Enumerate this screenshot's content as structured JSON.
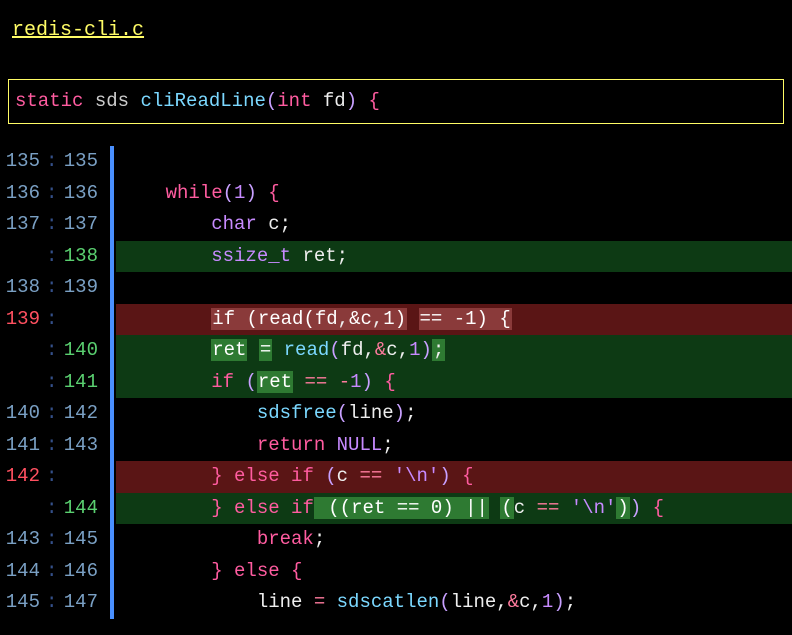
{
  "filename": "redis-cli.c",
  "hunk": {
    "kw1": "static",
    "type": "sds",
    "fn": "cliReadLine",
    "paren_open": "(",
    "argtype": "int",
    "argname": "fd",
    "paren_close": ")",
    "brace": "{"
  },
  "sep": ":",
  "lines": [
    {
      "old": "135",
      "new": "135",
      "kind": "ctx",
      "tokens": []
    },
    {
      "old": "136",
      "new": "136",
      "kind": "ctx",
      "tokens": [
        {
          "t": "plain",
          "v": "    "
        },
        {
          "t": "kw",
          "v": "while"
        },
        {
          "t": "br",
          "v": "("
        },
        {
          "t": "num",
          "v": "1"
        },
        {
          "t": "br",
          "v": ")"
        },
        {
          "t": "plain",
          "v": " "
        },
        {
          "t": "cb",
          "v": "{"
        }
      ]
    },
    {
      "old": "137",
      "new": "137",
      "kind": "ctx",
      "tokens": [
        {
          "t": "plain",
          "v": "        "
        },
        {
          "t": "type",
          "v": "char"
        },
        {
          "t": "plain",
          "v": " c"
        },
        {
          "t": "punc",
          "v": ";"
        }
      ]
    },
    {
      "old": "",
      "new": "138",
      "kind": "add",
      "tokens": [
        {
          "t": "plain",
          "v": "        "
        },
        {
          "t": "type",
          "v": "ssize_t"
        },
        {
          "t": "plain",
          "v": " ret"
        },
        {
          "t": "punc",
          "v": ";"
        }
      ]
    },
    {
      "old": "138",
      "new": "139",
      "kind": "ctx",
      "tokens": []
    },
    {
      "old": "139",
      "new": "",
      "kind": "del",
      "tokens": [
        {
          "t": "plain",
          "v": "        "
        },
        {
          "t": "hl-del",
          "children": [
            {
              "t": "kw",
              "v": "if"
            },
            {
              "t": "plain",
              "v": " "
            },
            {
              "t": "br",
              "v": "("
            },
            {
              "t": "id",
              "v": "read"
            },
            {
              "t": "br",
              "v": "("
            },
            {
              "t": "id",
              "v": "fd"
            },
            {
              "t": "punc",
              "v": ","
            },
            {
              "t": "op",
              "v": "&"
            },
            {
              "t": "id",
              "v": "c"
            },
            {
              "t": "punc",
              "v": ","
            },
            {
              "t": "num",
              "v": "1"
            },
            {
              "t": "br",
              "v": ")"
            }
          ]
        },
        {
          "t": "plain",
          "v": " "
        },
        {
          "t": "hl-del",
          "children": [
            {
              "t": "op",
              "v": "=="
            },
            {
              "t": "plain",
              "v": " "
            },
            {
              "t": "op",
              "v": "-"
            },
            {
              "t": "num",
              "v": "1"
            },
            {
              "t": "br",
              "v": ")"
            },
            {
              "t": "plain",
              "v": " "
            },
            {
              "t": "cb",
              "v": "{"
            }
          ]
        }
      ]
    },
    {
      "old": "",
      "new": "140",
      "kind": "add",
      "tokens": [
        {
          "t": "plain",
          "v": "        "
        },
        {
          "t": "hl-add",
          "children": [
            {
              "t": "id",
              "v": "ret"
            }
          ]
        },
        {
          "t": "plain",
          "v": " "
        },
        {
          "t": "hl-add",
          "children": [
            {
              "t": "op",
              "v": "="
            }
          ]
        },
        {
          "t": "plain",
          "v": " "
        },
        {
          "t": "fn",
          "v": "read"
        },
        {
          "t": "br",
          "v": "("
        },
        {
          "t": "id",
          "v": "fd"
        },
        {
          "t": "punc",
          "v": ","
        },
        {
          "t": "op",
          "v": "&"
        },
        {
          "t": "id",
          "v": "c"
        },
        {
          "t": "punc",
          "v": ","
        },
        {
          "t": "num",
          "v": "1"
        },
        {
          "t": "br",
          "v": ")"
        },
        {
          "t": "hl-add",
          "children": [
            {
              "t": "punc",
              "v": ";"
            }
          ]
        }
      ]
    },
    {
      "old": "",
      "new": "141",
      "kind": "add",
      "tokens": [
        {
          "t": "plain",
          "v": "        "
        },
        {
          "t": "kw",
          "v": "if"
        },
        {
          "t": "plain",
          "v": " "
        },
        {
          "t": "br",
          "v": "("
        },
        {
          "t": "hl-add",
          "children": [
            {
              "t": "id",
              "v": "ret"
            }
          ]
        },
        {
          "t": "plain",
          "v": " "
        },
        {
          "t": "op",
          "v": "=="
        },
        {
          "t": "plain",
          "v": " "
        },
        {
          "t": "op",
          "v": "-"
        },
        {
          "t": "num",
          "v": "1"
        },
        {
          "t": "br",
          "v": ")"
        },
        {
          "t": "plain",
          "v": " "
        },
        {
          "t": "cb",
          "v": "{"
        }
      ]
    },
    {
      "old": "140",
      "new": "142",
      "kind": "ctx",
      "tokens": [
        {
          "t": "plain",
          "v": "            "
        },
        {
          "t": "fn",
          "v": "sdsfree"
        },
        {
          "t": "br",
          "v": "("
        },
        {
          "t": "id",
          "v": "line"
        },
        {
          "t": "br",
          "v": ")"
        },
        {
          "t": "punc",
          "v": ";"
        }
      ]
    },
    {
      "old": "141",
      "new": "143",
      "kind": "ctx",
      "tokens": [
        {
          "t": "plain",
          "v": "            "
        },
        {
          "t": "kw",
          "v": "return"
        },
        {
          "t": "plain",
          "v": " "
        },
        {
          "t": "null",
          "v": "NULL"
        },
        {
          "t": "punc",
          "v": ";"
        }
      ]
    },
    {
      "old": "142",
      "new": "",
      "kind": "del",
      "tokens": [
        {
          "t": "plain",
          "v": "        "
        },
        {
          "t": "cb",
          "v": "}"
        },
        {
          "t": "plain",
          "v": " "
        },
        {
          "t": "kw",
          "v": "else"
        },
        {
          "t": "plain",
          "v": " "
        },
        {
          "t": "kw",
          "v": "if"
        },
        {
          "t": "plain",
          "v": " "
        },
        {
          "t": "br",
          "v": "("
        },
        {
          "t": "id",
          "v": "c"
        },
        {
          "t": "plain",
          "v": " "
        },
        {
          "t": "op",
          "v": "=="
        },
        {
          "t": "plain",
          "v": " "
        },
        {
          "t": "str",
          "v": "'\\n'"
        },
        {
          "t": "br",
          "v": ")"
        },
        {
          "t": "plain",
          "v": " "
        },
        {
          "t": "cb",
          "v": "{"
        }
      ]
    },
    {
      "old": "",
      "new": "144",
      "kind": "add",
      "tokens": [
        {
          "t": "plain",
          "v": "        "
        },
        {
          "t": "cb",
          "v": "}"
        },
        {
          "t": "plain",
          "v": " "
        },
        {
          "t": "kw",
          "v": "else"
        },
        {
          "t": "plain",
          "v": " "
        },
        {
          "t": "kw",
          "v": "if"
        },
        {
          "t": "hl-add",
          "children": [
            {
              "t": "plain",
              "v": " "
            }
          ]
        },
        {
          "t": "hl-add",
          "children": [
            {
              "t": "br",
              "v": "(("
            },
            {
              "t": "id",
              "v": "ret"
            },
            {
              "t": "plain",
              "v": " "
            },
            {
              "t": "op",
              "v": "=="
            },
            {
              "t": "plain",
              "v": " "
            },
            {
              "t": "num",
              "v": "0"
            },
            {
              "t": "br",
              "v": ")"
            },
            {
              "t": "plain",
              "v": " "
            },
            {
              "t": "op",
              "v": "||"
            }
          ]
        },
        {
          "t": "plain",
          "v": " "
        },
        {
          "t": "hl-add",
          "children": [
            {
              "t": "br",
              "v": "("
            }
          ]
        },
        {
          "t": "id",
          "v": "c"
        },
        {
          "t": "plain",
          "v": " "
        },
        {
          "t": "op",
          "v": "=="
        },
        {
          "t": "plain",
          "v": " "
        },
        {
          "t": "str",
          "v": "'\\n'"
        },
        {
          "t": "hl-add",
          "children": [
            {
              "t": "br",
              "v": ")"
            }
          ]
        },
        {
          "t": "br",
          "v": ")"
        },
        {
          "t": "plain",
          "v": " "
        },
        {
          "t": "cb",
          "v": "{"
        }
      ]
    },
    {
      "old": "143",
      "new": "145",
      "kind": "ctx",
      "tokens": [
        {
          "t": "plain",
          "v": "            "
        },
        {
          "t": "kw",
          "v": "break"
        },
        {
          "t": "punc",
          "v": ";"
        }
      ]
    },
    {
      "old": "144",
      "new": "146",
      "kind": "ctx",
      "tokens": [
        {
          "t": "plain",
          "v": "        "
        },
        {
          "t": "cb",
          "v": "}"
        },
        {
          "t": "plain",
          "v": " "
        },
        {
          "t": "kw",
          "v": "else"
        },
        {
          "t": "plain",
          "v": " "
        },
        {
          "t": "cb",
          "v": "{"
        }
      ]
    },
    {
      "old": "145",
      "new": "147",
      "kind": "ctx",
      "tokens": [
        {
          "t": "plain",
          "v": "            "
        },
        {
          "t": "id",
          "v": "line"
        },
        {
          "t": "plain",
          "v": " "
        },
        {
          "t": "op",
          "v": "="
        },
        {
          "t": "plain",
          "v": " "
        },
        {
          "t": "fn",
          "v": "sdscatlen"
        },
        {
          "t": "br",
          "v": "("
        },
        {
          "t": "id",
          "v": "line"
        },
        {
          "t": "punc",
          "v": ","
        },
        {
          "t": "op",
          "v": "&"
        },
        {
          "t": "id",
          "v": "c"
        },
        {
          "t": "punc",
          "v": ","
        },
        {
          "t": "num",
          "v": "1"
        },
        {
          "t": "br",
          "v": ")"
        },
        {
          "t": "punc",
          "v": ";"
        }
      ]
    }
  ]
}
